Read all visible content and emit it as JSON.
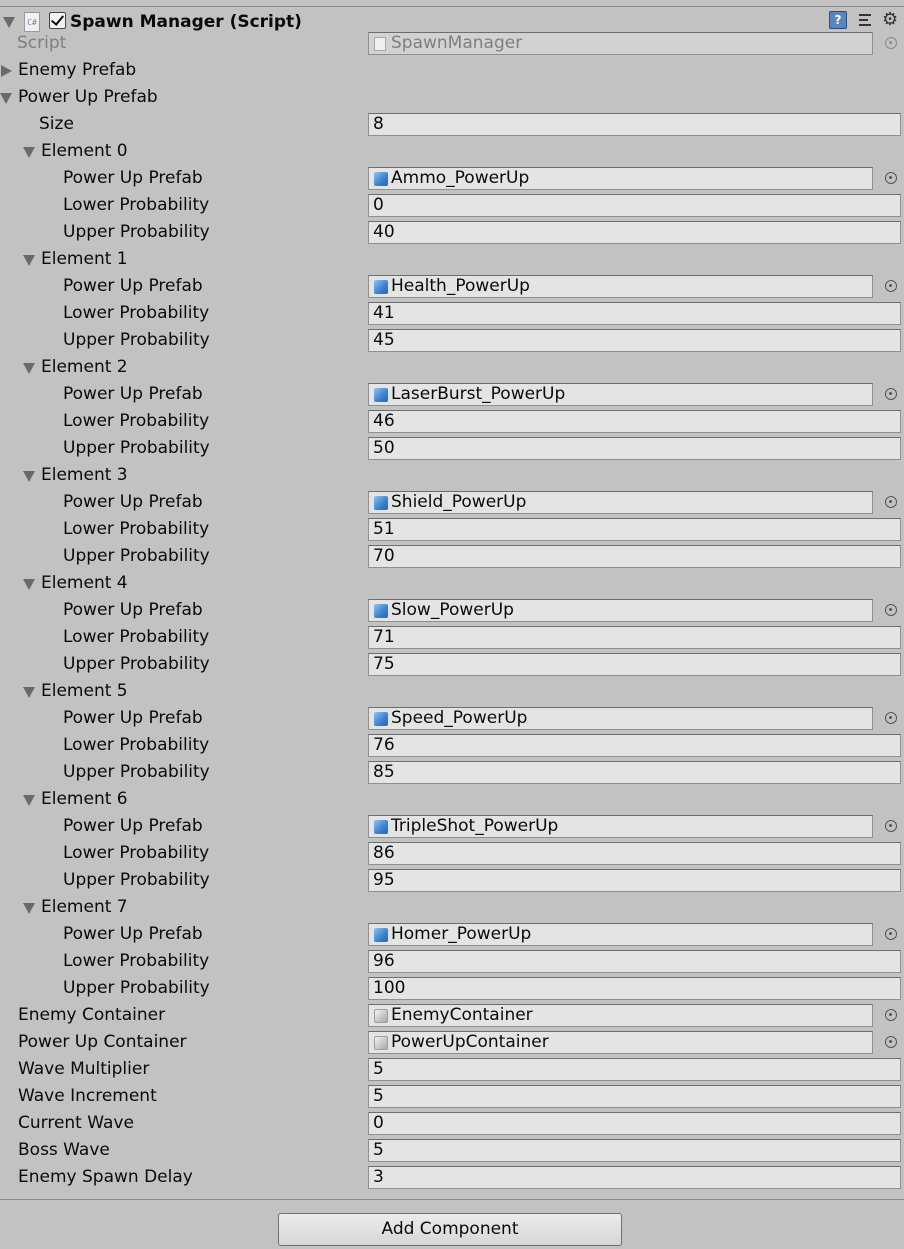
{
  "component": {
    "title": "Spawn Manager (Script)",
    "script_icon_text": "C#",
    "help_icon_text": "?"
  },
  "script_row": {
    "label": "Script",
    "value": "SpawnManager"
  },
  "enemy_prefab": {
    "label": "Enemy Prefab"
  },
  "power_up_prefab": {
    "label": "Power Up Prefab",
    "size_label": "Size",
    "size": "8",
    "element_field_labels": {
      "prefab": "Power Up Prefab",
      "lower": "Lower Probability",
      "upper": "Upper Probability"
    },
    "elements": [
      {
        "label": "Element 0",
        "prefab": "Ammo_PowerUp",
        "lower": "0",
        "upper": "40"
      },
      {
        "label": "Element 1",
        "prefab": "Health_PowerUp",
        "lower": "41",
        "upper": "45"
      },
      {
        "label": "Element 2",
        "prefab": "LaserBurst_PowerUp",
        "lower": "46",
        "upper": "50"
      },
      {
        "label": "Element 3",
        "prefab": "Shield_PowerUp",
        "lower": "51",
        "upper": "70"
      },
      {
        "label": "Element 4",
        "prefab": "Slow_PowerUp",
        "lower": "71",
        "upper": "75"
      },
      {
        "label": "Element 5",
        "prefab": "Speed_PowerUp",
        "lower": "76",
        "upper": "85"
      },
      {
        "label": "Element 6",
        "prefab": "TripleShot_PowerUp",
        "lower": "86",
        "upper": "95"
      },
      {
        "label": "Element 7",
        "prefab": "Homer_PowerUp",
        "lower": "96",
        "upper": "100"
      }
    ]
  },
  "fields": {
    "enemy_container": {
      "label": "Enemy Container",
      "value": "EnemyContainer"
    },
    "power_up_container": {
      "label": "Power Up Container",
      "value": "PowerUpContainer"
    },
    "wave_multiplier": {
      "label": "Wave Multiplier",
      "value": "5"
    },
    "wave_increment": {
      "label": "Wave Increment",
      "value": "5"
    },
    "current_wave": {
      "label": "Current Wave",
      "value": "0"
    },
    "boss_wave": {
      "label": "Boss Wave",
      "value": "5"
    },
    "enemy_spawn_delay": {
      "label": "Enemy Spawn Delay",
      "value": "3"
    }
  },
  "add_component": {
    "label": "Add Component"
  },
  "icons": {
    "foldout_open": "triangle-down-icon",
    "foldout_closed": "triangle-right-icon",
    "prefab": "blue-cube-icon",
    "game_object": "grey-cube-icon",
    "object_picker": "circle-dot-icon",
    "help": "help-book-icon",
    "presets": "presets-icon",
    "settings": "gear-icon"
  },
  "colors": {
    "background": "#c2c2c2",
    "field": "#e4e4e4",
    "prefab_icon": "#3f86d0"
  }
}
